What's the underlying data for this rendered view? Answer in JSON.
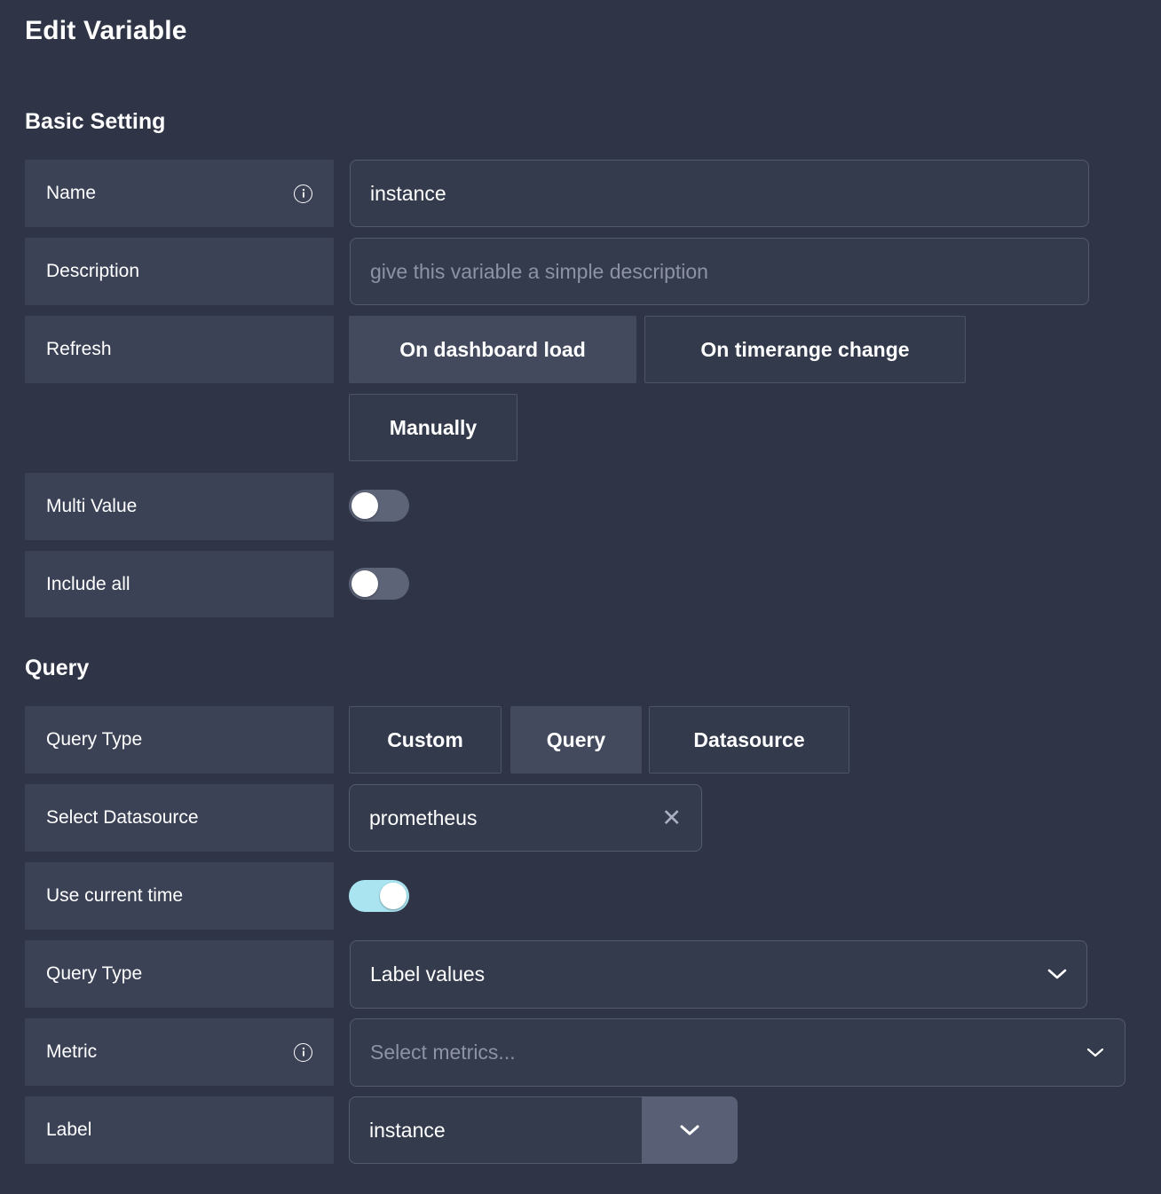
{
  "header": {
    "title": "Edit Variable"
  },
  "sections": {
    "basic": {
      "heading": "Basic Setting",
      "rows": {
        "name": {
          "label": "Name",
          "info_icon": "info-icon",
          "value": "instance"
        },
        "description": {
          "label": "Description",
          "placeholder": "give this variable a simple description",
          "value": ""
        },
        "refresh": {
          "label": "Refresh",
          "options": [
            "On dashboard load",
            "On timerange change",
            "Manually"
          ],
          "selected": "On dashboard load"
        },
        "multi_value": {
          "label": "Multi Value",
          "toggle": "off"
        },
        "include_all": {
          "label": "Include all",
          "toggle": "off"
        }
      }
    },
    "query": {
      "heading": "Query",
      "rows": {
        "query_type": {
          "label": "Query Type",
          "options": [
            "Custom",
            "Query",
            "Datasource"
          ],
          "selected": "Query"
        },
        "select_datasource": {
          "label": "Select Datasource",
          "value": "prometheus",
          "clear_icon": "close-icon"
        },
        "use_current_time": {
          "label": "Use current time",
          "toggle": "on"
        },
        "query_type_2": {
          "label": "Query Type",
          "value": "Label values",
          "chevron": "chevron-down-icon"
        },
        "metric": {
          "label": "Metric",
          "info_icon": "info-icon",
          "placeholder": "Select metrics...",
          "value": "",
          "chevron": "chevron-down-icon"
        },
        "label": {
          "label": "Label",
          "value": "instance",
          "chevron": "chevron-down-icon"
        }
      }
    }
  },
  "colors": {
    "page_bg": "#2f3546",
    "row_bg": "#3b4256",
    "field_bg": "#343b4d",
    "field_border": "#545b6e",
    "seg_selected_bg": "#434a5e",
    "toggle_off": "#5d6478",
    "toggle_on": "#a9e4f0",
    "split_button_bg": "#596075",
    "text": "#ffffff",
    "placeholder": "#8d93a4"
  }
}
